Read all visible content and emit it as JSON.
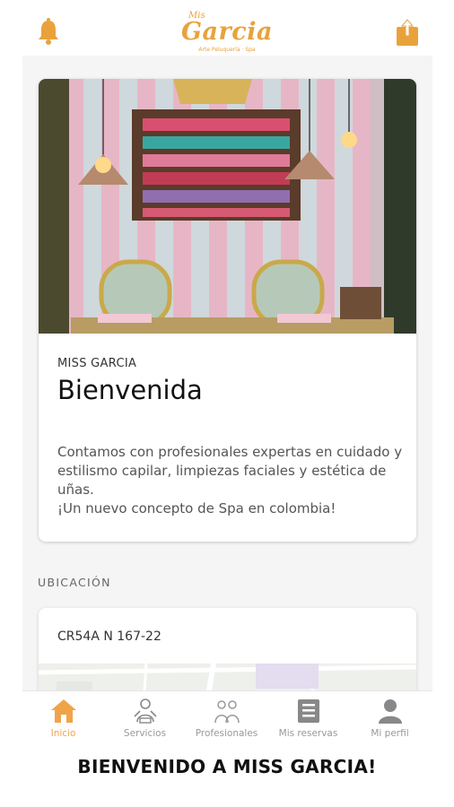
{
  "header": {
    "logo_prefix": "Mis",
    "logo_brand": "Garcia",
    "logo_tagline": "Arte Peluquería · Spa",
    "icons": {
      "left": "bell-icon",
      "right": "share-icon"
    },
    "accent": "#F0A44A"
  },
  "hero": {
    "overline": "MISS GARCIA",
    "title": "Bienvenida",
    "text_lines": [
      "Contamos con profesionales expertas en cuidado y",
      "estilismo capilar, limpiezas faciales y estética de",
      "uñas.",
      "¡Un nuevo concepto de Spa en colombia!"
    ]
  },
  "location": {
    "section_label": "UBICACIÓN",
    "address": "CR54A N 167-22"
  },
  "nav": {
    "items": [
      {
        "label": "Inicio",
        "icon": "home-icon",
        "active": true
      },
      {
        "label": "Servicios",
        "icon": "services-icon",
        "active": false
      },
      {
        "label": "Profesionales",
        "icon": "professionals-icon",
        "active": false
      },
      {
        "label": "Mis reservas",
        "icon": "reservations-icon",
        "active": false
      },
      {
        "label": "Mi perfil",
        "icon": "profile-icon",
        "active": false
      }
    ]
  },
  "caption": "BIENVENIDO A MISS GARCIA!"
}
